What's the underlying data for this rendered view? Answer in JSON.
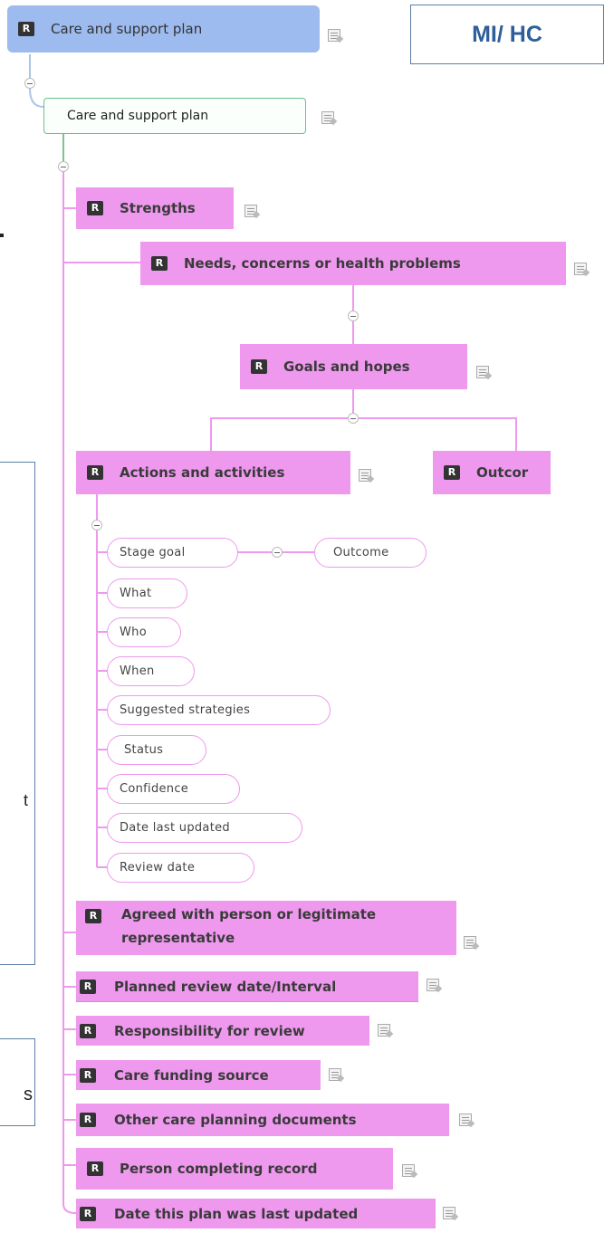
{
  "root": {
    "badge": "R",
    "label": "Care and support plan"
  },
  "tag": {
    "label": "MI/ HC",
    "color": "#2f5f9a"
  },
  "child": {
    "label": "Care and support plan"
  },
  "nodes": {
    "strengths": "Strengths",
    "needs": "Needs, concerns or health problems",
    "goals": "Goals and hopes",
    "actions": "Actions and activities",
    "outcomes": "Outcor",
    "agreed_line1": "Agreed with person or legitimate",
    "agreed_line2": "representative",
    "planned_review": "Planned review date/Interval",
    "responsibility": "Responsibility for review",
    "funding": "Care funding source",
    "other_docs": "Other care planning documents",
    "person_completing": "Person completing record",
    "date_updated": "Date this plan was last updated"
  },
  "action_items": {
    "stage_goal": "Stage goal",
    "outcome": "Outcome",
    "what": "What",
    "who": "Who",
    "when": "When",
    "suggested": "Suggested strategies",
    "status": "Status",
    "confidence": "Confidence",
    "date_last_updated": "Date last updated",
    "review_date": "Review date"
  },
  "left_fragments": {
    "frag1": "t",
    "frag2": "s"
  },
  "colors": {
    "pink": "#ee99ee",
    "root_blue": "#9dbbee",
    "child_border": "#6bbf8a",
    "frame": "#5b7fa6"
  }
}
